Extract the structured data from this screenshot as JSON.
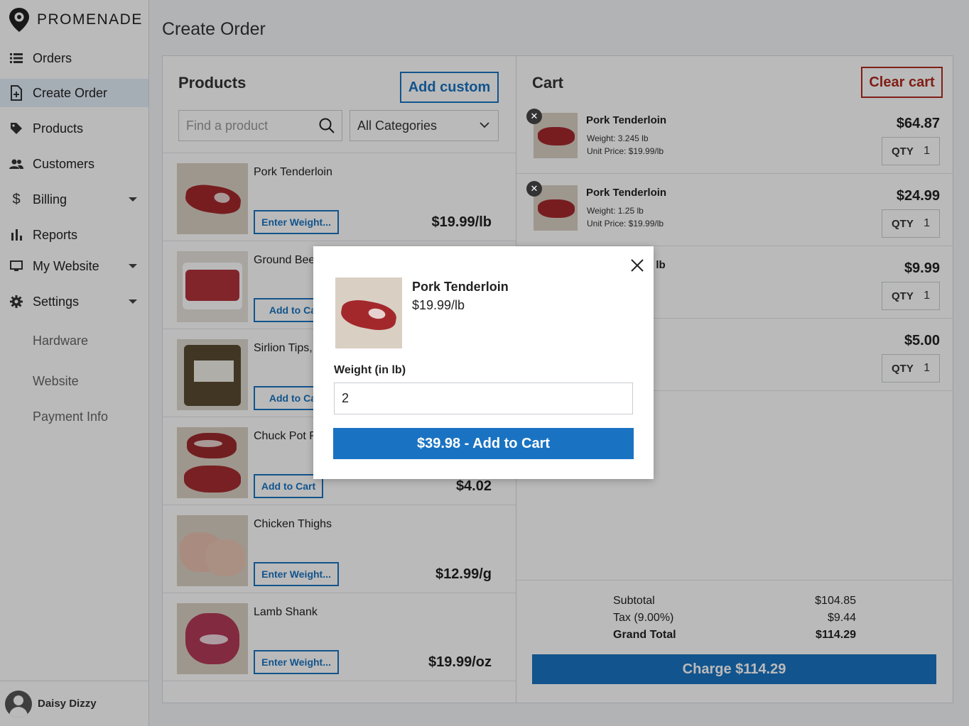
{
  "brand": {
    "name": "PROMENADE"
  },
  "sidebar": {
    "items": [
      {
        "label": "Orders",
        "icon": "list-icon"
      },
      {
        "label": "Create Order",
        "icon": "add-document-icon"
      },
      {
        "label": "Products",
        "icon": "tag-icon"
      },
      {
        "label": "Customers",
        "icon": "people-icon"
      },
      {
        "label": "Billing",
        "icon": "dollar-icon"
      },
      {
        "label": "Reports",
        "icon": "bar-chart-icon"
      },
      {
        "label": "My Website",
        "icon": "monitor-icon"
      },
      {
        "label": "Settings",
        "icon": "gear-icon"
      }
    ],
    "sub_items": [
      "Hardware",
      "Website",
      "Payment Info"
    ],
    "user": {
      "name": "Daisy Dizzy"
    }
  },
  "page": {
    "title": "Create Order"
  },
  "products": {
    "title": "Products",
    "add_custom_label": "Add custom",
    "search_placeholder": "Find a product",
    "category_selected": "All Categories",
    "rows": [
      {
        "name": "Pork Tenderloin",
        "button": "Enter Weight...",
        "price": "$19.99/lb"
      },
      {
        "name": "Ground Beef",
        "button": "Add to Cart",
        "price": ""
      },
      {
        "name": "Sirlion Tips,",
        "button": "Add to Cart",
        "price": ""
      },
      {
        "name": "Chuck Pot R",
        "button": "Add to Cart",
        "price": "$4.02"
      },
      {
        "name": "Chicken Thighs",
        "button": "Enter Weight...",
        "price": "$12.99/g"
      },
      {
        "name": "Lamb Shank",
        "button": "Enter Weight...",
        "price": "$19.99/oz"
      }
    ]
  },
  "cart": {
    "title": "Cart",
    "clear_label": "Clear cart",
    "qty_label": "QTY",
    "items": [
      {
        "name": "Pork Tenderloin",
        "weight": "Weight: 3.245 lb",
        "unit_price": "Unit Price: $19.99/lb",
        "price": "$64.87",
        "qty": "1"
      },
      {
        "name": "Pork Tenderloin",
        "weight": "Weight: 1.25 lb",
        "unit_price": "Unit Price: $19.99/lb",
        "price": "$24.99",
        "qty": "1"
      },
      {
        "name": "l lb",
        "weight": "",
        "unit_price": "",
        "price": "$9.99",
        "qty": "1"
      },
      {
        "name": "",
        "weight": "",
        "unit_price": "",
        "price": "$5.00",
        "qty": "1"
      }
    ],
    "totals": {
      "subtotal_label": "Subtotal",
      "subtotal": "$104.85",
      "tax_label": "Tax (9.00%)",
      "tax": "$9.44",
      "grand_label": "Grand Total",
      "grand": "$114.29"
    },
    "charge_label": "Charge $114.29"
  },
  "modal": {
    "product_name": "Pork Tenderloin",
    "product_price": "$19.99/lb",
    "weight_label": "Weight (in lb)",
    "weight_value": "2",
    "add_button": "$39.98 - Add to Cart"
  }
}
